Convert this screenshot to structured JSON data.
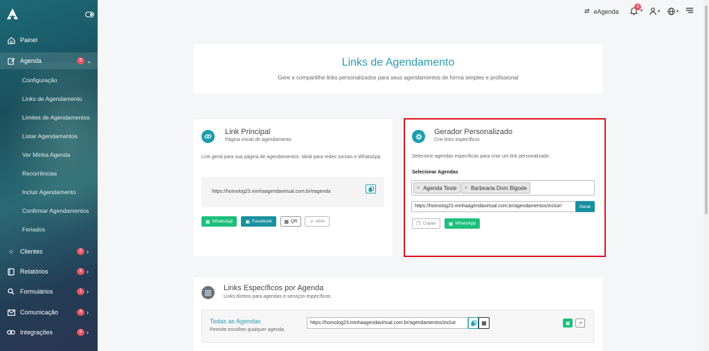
{
  "sidebar": {
    "items": [
      {
        "label": "Painel"
      },
      {
        "label": "Agenda",
        "badge": "9"
      },
      {
        "label": "Clientes",
        "badge": "2"
      },
      {
        "label": "Relatórios",
        "badge": "3"
      },
      {
        "label": "Formulários",
        "badge": "1"
      },
      {
        "label": "Comunicação",
        "badge": "4"
      },
      {
        "label": "Integrações",
        "badge": "6"
      }
    ],
    "sub_items": [
      "Configuração",
      "Links de Agendamento",
      "Limites de Agendamentos",
      "Listar Agendamentos",
      "Ver Minha Agenda",
      "Recorrências",
      "Incluir Agendamento",
      "Confirmar Agendamentos",
      "Feriados"
    ]
  },
  "topbar": {
    "switch_label": "eAgenda",
    "notification_count": "3"
  },
  "page": {
    "title": "Links de Agendamento",
    "subtitle": "Gere e compartilhe links personalizados para seus agendamentos de forma simples e profissional"
  },
  "link_principal": {
    "title": "Link Principal",
    "subtitle": "Página inicial de agendamento",
    "description": "Link geral para sua página de agendamentos. Ideal para redes sociais e WhatsApp.",
    "url": "https://homolog23.minhaagendavirtual.com.br/eagenda",
    "buttons": {
      "whatsapp": "WhatsApp",
      "facebook": "Facebook",
      "qr": "QR",
      "abrir": "Abrir"
    }
  },
  "gerador": {
    "title": "Gerador Personalizado",
    "subtitle": "Crie links específicos",
    "description": "Selecione agendas específicas para criar um link personalizado.",
    "select_label": "Selecionar Agendas",
    "tags": [
      "Agenda Teste",
      "Barbearia Dom Bigode"
    ],
    "generated_url": "https://homolog23.minhaagendavirtual.com.br/agendamentos/incluir/",
    "gerar_label": "Gerar",
    "copiar_label": "Copiar",
    "whatsapp_label": "WhatsApp"
  },
  "especificos": {
    "title": "Links Específicos por Agenda",
    "subtitle": "Links diretos para agendas e serviços específicos",
    "row": {
      "name": "Todas as Agendas",
      "desc": "Permite escolher qualquer agenda",
      "url": "https://homolog23.minhaagendavirtual.com.br/agendamentos/incluir"
    }
  },
  "colors": {
    "accent": "#2a9cb1",
    "whatsapp": "#1cbf7c",
    "teal": "#18909f",
    "badge": "#e9545f",
    "highlight": "#e0101e"
  }
}
